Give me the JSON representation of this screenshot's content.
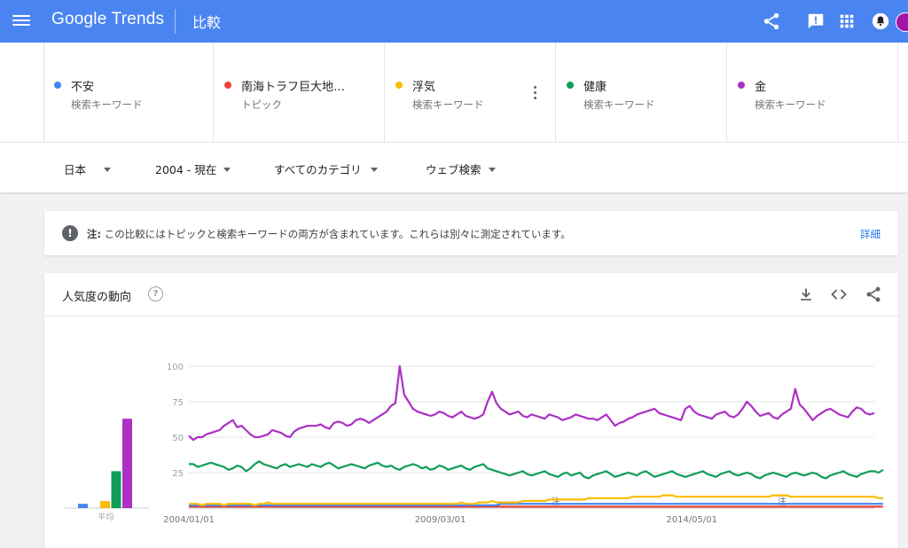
{
  "header": {
    "brand": "Google Trends",
    "page_title": "比較"
  },
  "terms": [
    {
      "name": "不安",
      "type": "検索キーワード",
      "color": "#4285f4"
    },
    {
      "name": "南海トラフ巨大地…",
      "type": "トピック",
      "color": "#ea4335"
    },
    {
      "name": "浮気",
      "type": "検索キーワード",
      "color": "#fbbc04"
    },
    {
      "name": "健康",
      "type": "検索キーワード",
      "color": "#0f9d58"
    },
    {
      "name": "金",
      "type": "検索キーワード",
      "color": "#ab30c4"
    }
  ],
  "filters": {
    "region": "日本",
    "period": "2004 - 現在",
    "category": "すべてのカテゴリ",
    "search_type": "ウェブ検索"
  },
  "notice": {
    "label": "注:",
    "text": "この比較にはトピックと検索キーワードの両方が含まれています。これらは別々に測定されています。",
    "link": "詳細"
  },
  "card": {
    "title": "人気度の動向",
    "help": "?"
  },
  "chart_data": {
    "type": "line",
    "y_ticks": [
      100,
      75,
      50,
      25
    ],
    "ylim": [
      0,
      100
    ],
    "x_labels": [
      "2004/01/01",
      "2009/03/01",
      "2014/05/01"
    ],
    "x_range": [
      "2004-01",
      "2018-02"
    ],
    "average_label": "平均",
    "note_marker": "注",
    "averages": [
      {
        "name": "不安",
        "value": 3
      },
      {
        "name": "南海トラフ巨大地…",
        "value": 0
      },
      {
        "name": "浮気",
        "value": 5
      },
      {
        "name": "健康",
        "value": 26
      },
      {
        "name": "金",
        "value": 63
      }
    ],
    "series": [
      {
        "name": "金",
        "color": "#ab30c4",
        "values": [
          51,
          48,
          50,
          50,
          52,
          53,
          54,
          55,
          58,
          60,
          62,
          57,
          58,
          55,
          52,
          50,
          50,
          51,
          52,
          55,
          54,
          53,
          51,
          50,
          54,
          56,
          57,
          58,
          58,
          58,
          59,
          57,
          56,
          60,
          61,
          60,
          58,
          59,
          62,
          63,
          62,
          60,
          62,
          64,
          66,
          68,
          72,
          74,
          100,
          80,
          75,
          70,
          68,
          67,
          66,
          65,
          66,
          68,
          67,
          65,
          64,
          66,
          68,
          65,
          64,
          63,
          64,
          66,
          75,
          82,
          74,
          70,
          68,
          66,
          67,
          68,
          65,
          64,
          66,
          65,
          64,
          63,
          66,
          65,
          64,
          62,
          63,
          64,
          66,
          65,
          64,
          63,
          63,
          62,
          64,
          66,
          62,
          58,
          60,
          61,
          63,
          64,
          66,
          67,
          68,
          69,
          70,
          67,
          66,
          65,
          64,
          63,
          62,
          70,
          72,
          68,
          66,
          65,
          64,
          63,
          66,
          67,
          68,
          65,
          64,
          66,
          70,
          75,
          72,
          68,
          65,
          66,
          67,
          64,
          63,
          66,
          68,
          70,
          84,
          73,
          70,
          66,
          62,
          65,
          67,
          69,
          70,
          68,
          66,
          65,
          64,
          68,
          71,
          70,
          67,
          66,
          67
        ]
      },
      {
        "name": "健康",
        "color": "#0f9d58",
        "values": [
          31,
          31,
          29,
          30,
          31,
          32,
          31,
          30,
          29,
          27,
          28,
          30,
          29,
          26,
          28,
          31,
          33,
          31,
          30,
          29,
          28,
          30,
          31,
          29,
          30,
          31,
          30,
          29,
          31,
          30,
          29,
          31,
          32,
          30,
          28,
          29,
          30,
          31,
          30,
          29,
          28,
          30,
          31,
          32,
          30,
          29,
          30,
          28,
          27,
          29,
          30,
          31,
          30,
          28,
          29,
          27,
          28,
          30,
          29,
          27,
          28,
          29,
          30,
          28,
          27,
          29,
          30,
          31,
          28,
          27,
          26,
          25,
          24,
          23,
          24,
          25,
          26,
          24,
          23,
          24,
          25,
          26,
          24,
          23,
          22,
          24,
          25,
          23,
          24,
          25,
          22,
          21,
          23,
          24,
          25,
          26,
          24,
          22,
          23,
          24,
          25,
          24,
          23,
          25,
          26,
          24,
          22,
          23,
          24,
          25,
          26,
          24,
          23,
          22,
          23,
          24,
          25,
          26,
          24,
          23,
          22,
          24,
          25,
          26,
          24,
          23,
          24,
          25,
          24,
          22,
          21,
          23,
          24,
          25,
          24,
          23,
          22,
          24,
          25,
          24,
          23,
          24,
          25,
          24,
          22,
          21,
          23,
          24,
          25,
          26,
          24,
          23,
          22,
          24,
          25,
          26,
          26,
          25,
          27
        ]
      },
      {
        "name": "浮気",
        "color": "#fbbc04",
        "values": [
          3,
          3,
          3,
          2,
          3,
          3,
          3,
          3,
          2,
          3,
          3,
          3,
          3,
          3,
          3,
          2,
          3,
          3,
          4,
          3,
          3,
          3,
          3,
          3,
          3,
          3,
          3,
          3,
          3,
          3,
          3,
          3,
          3,
          3,
          3,
          3,
          3,
          3,
          3,
          3,
          3,
          3,
          3,
          3,
          3,
          3,
          3,
          3,
          3,
          3,
          3,
          3,
          3,
          3,
          3,
          3,
          3,
          3,
          3,
          3,
          3,
          3,
          4,
          3,
          3,
          3,
          4,
          4,
          4,
          5,
          4,
          4,
          4,
          4,
          4,
          4,
          5,
          5,
          5,
          5,
          5,
          5,
          6,
          6,
          6,
          6,
          6,
          6,
          6,
          6,
          6,
          7,
          7,
          7,
          7,
          7,
          7,
          7,
          7,
          7,
          7,
          8,
          8,
          8,
          8,
          8,
          8,
          8,
          9,
          9,
          9,
          8,
          8,
          8,
          8,
          8,
          8,
          8,
          8,
          8,
          8,
          8,
          8,
          8,
          8,
          8,
          8,
          8,
          8,
          8,
          8,
          8,
          8,
          9,
          9,
          9,
          9,
          8,
          8,
          8,
          8,
          8,
          8,
          8,
          8,
          8,
          8,
          8,
          8,
          8,
          8,
          8,
          8,
          8,
          8,
          8,
          8,
          7,
          7
        ]
      },
      {
        "name": "不安",
        "color": "#4285f4",
        "values": [
          2,
          2,
          2,
          2,
          2,
          2,
          2,
          2,
          2,
          2,
          2,
          2,
          2,
          2,
          2,
          2,
          2,
          2,
          2,
          2,
          2,
          2,
          2,
          2,
          2,
          2,
          2,
          2,
          2,
          2,
          2,
          2,
          2,
          2,
          2,
          2,
          2,
          2,
          2,
          2,
          2,
          2,
          2,
          2,
          2,
          2,
          2,
          2,
          2,
          2,
          2,
          2,
          2,
          2,
          2,
          2,
          2,
          2,
          2,
          2,
          2,
          2,
          2,
          2,
          2,
          2,
          2,
          2,
          2,
          2,
          2,
          3,
          3,
          3,
          3,
          3,
          3,
          3,
          3,
          3,
          3,
          3,
          3,
          3,
          3,
          3,
          3,
          3,
          3,
          3,
          3,
          3,
          3,
          3,
          3,
          3,
          3,
          3,
          3,
          3,
          3,
          3,
          3,
          3,
          3,
          3,
          3,
          3,
          3,
          3,
          3,
          3,
          3,
          3,
          3,
          3,
          3,
          3,
          3,
          3,
          3,
          3,
          3,
          3,
          3,
          3,
          3,
          3,
          3,
          3,
          3,
          3,
          3,
          3,
          3,
          3,
          3,
          3,
          3,
          3,
          3,
          3,
          3,
          3,
          3,
          3,
          3,
          3,
          3,
          3,
          3,
          3,
          3,
          3,
          3,
          3,
          3,
          3,
          3
        ]
      },
      {
        "name": "南海トラフ巨大地…",
        "color": "#ea4335",
        "values": [
          1,
          1,
          1,
          1,
          1,
          1,
          1,
          1,
          1,
          1,
          1,
          1,
          1,
          1,
          1,
          1,
          1,
          1,
          1,
          1,
          1,
          1,
          1,
          1,
          1,
          1,
          1,
          1,
          1,
          1,
          1,
          1,
          1,
          1,
          1,
          1,
          1,
          1,
          1,
          1,
          1,
          1,
          1,
          1,
          1,
          1,
          1,
          1,
          1,
          1,
          1,
          1,
          1,
          1,
          1,
          1,
          1,
          1,
          1,
          1,
          1,
          1,
          1,
          1,
          1,
          1,
          1,
          1,
          1,
          1,
          1,
          1,
          1,
          1,
          1,
          1,
          1,
          1,
          1,
          1,
          1,
          1,
          1,
          1,
          1,
          1,
          1,
          1,
          1,
          1,
          1,
          1,
          1,
          1,
          1,
          1,
          1,
          1,
          1,
          1,
          1,
          1,
          1,
          1,
          1,
          1,
          1,
          1,
          1,
          1,
          1,
          1,
          1,
          1,
          1,
          1,
          1,
          1,
          1,
          1,
          1,
          1,
          1,
          1,
          1,
          1,
          1,
          1,
          1,
          1,
          1,
          1,
          1,
          1,
          1,
          1,
          1,
          1,
          1,
          1,
          1,
          1,
          1,
          1,
          1,
          1,
          1,
          1,
          1,
          1,
          1,
          1,
          1,
          1,
          1,
          1,
          1,
          1,
          1
        ]
      }
    ]
  }
}
